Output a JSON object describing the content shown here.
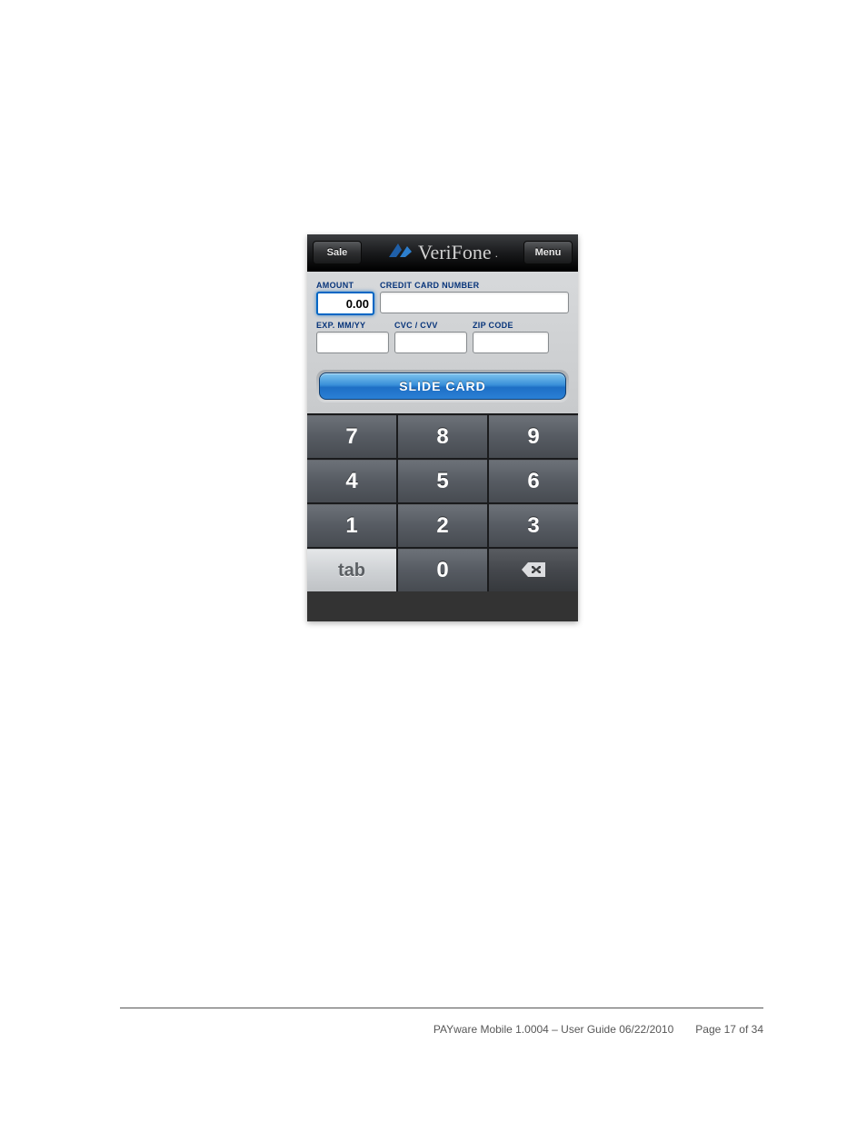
{
  "navbar": {
    "left_button": "Sale",
    "right_button": "Menu",
    "brand": "VeriFone"
  },
  "form": {
    "amount_label": "AMOUNT",
    "amount_value": "0.00",
    "card_label": "CREDIT CARD NUMBER",
    "card_value": "",
    "exp_label": "EXP. MM/YY",
    "exp_value": "",
    "cvv_label": "CVC / CVV",
    "cvv_value": "",
    "zip_label": "ZIP CODE",
    "zip_value": "",
    "slide_button": "SLIDE CARD"
  },
  "keypad": {
    "k7": "7",
    "k8": "8",
    "k9": "9",
    "k4": "4",
    "k5": "5",
    "k6": "6",
    "k1": "1",
    "k2": "2",
    "k3": "3",
    "tab": "tab",
    "k0": "0"
  },
  "footer": {
    "doc": "PAYware Mobile 1.0004 – User Guide 06/22/2010",
    "page": "Page 17 of 34"
  }
}
